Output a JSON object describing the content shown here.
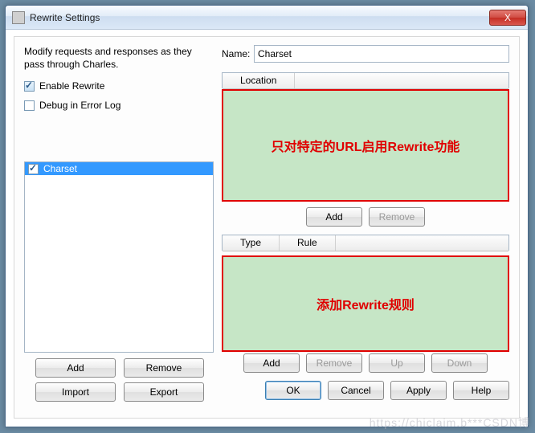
{
  "window": {
    "title": "Rewrite Settings",
    "close_glyph": "X"
  },
  "left": {
    "description": "Modify requests and responses as they pass through Charles.",
    "enable_label": "Enable Rewrite",
    "debug_label": "Debug in Error Log",
    "sets": [
      {
        "label": "Charset",
        "checked": true,
        "selected": true
      }
    ],
    "buttons": {
      "add": "Add",
      "remove": "Remove",
      "import": "Import",
      "export": "Export"
    }
  },
  "right": {
    "name_label": "Name:",
    "name_value": "Charset",
    "location_header": "Location",
    "location_buttons": {
      "add": "Add",
      "remove": "Remove"
    },
    "type_header": "Type",
    "rule_header": "Rule",
    "rule_buttons": {
      "add": "Add",
      "remove": "Remove",
      "up": "Up",
      "down": "Down"
    }
  },
  "annotations": {
    "top": "只对特定的URL启用Rewrite功能",
    "bottom": "添加Rewrite规则"
  },
  "bottom_buttons": {
    "ok": "OK",
    "cancel": "Cancel",
    "apply": "Apply",
    "help": "Help"
  },
  "watermark": "https://chiclaim.b***CSDN博"
}
